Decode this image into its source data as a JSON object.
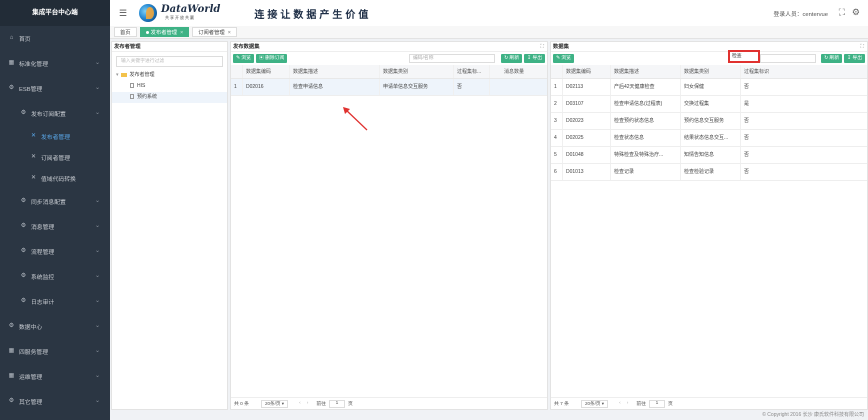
{
  "sidebar": {
    "brand": "集成平台中心端",
    "items": [
      {
        "label": "首页",
        "icon": "home-icon",
        "level": 0
      },
      {
        "label": "标准化管理",
        "icon": "grid-icon",
        "level": 0,
        "chevron": true
      },
      {
        "label": "ESB管理",
        "icon": "gear-icon",
        "level": 0,
        "chevron": true
      },
      {
        "label": "发布订阅配置",
        "icon": "gear-icon",
        "level": 1,
        "chevron": true
      },
      {
        "label": "发布者管理",
        "icon": "wrench-icon",
        "level": 2,
        "active": true
      },
      {
        "label": "订阅者管理",
        "icon": "wrench-icon",
        "level": 2
      },
      {
        "label": "值域代码转换",
        "icon": "wrench-icon",
        "level": 2
      },
      {
        "label": "同步消息配置",
        "icon": "gear-icon",
        "level": 1,
        "chevron": true
      },
      {
        "label": "消息管理",
        "icon": "gear-icon",
        "level": 1,
        "chevron": true
      },
      {
        "label": "流程管理",
        "icon": "gear-icon",
        "level": 1,
        "chevron": true
      },
      {
        "label": "系统监控",
        "icon": "gear-icon",
        "level": 1,
        "chevron": true
      },
      {
        "label": "日志审计",
        "icon": "gear-icon",
        "level": 1,
        "chevron": true
      },
      {
        "label": "数据中心",
        "icon": "gear-icon",
        "level": 0,
        "chevron": true
      },
      {
        "label": "四服务管理",
        "icon": "grid-icon",
        "level": 0,
        "chevron": true
      },
      {
        "label": "运维管理",
        "icon": "grid-icon",
        "level": 0,
        "chevron": true
      },
      {
        "label": "其它管理",
        "icon": "gear-icon",
        "level": 0,
        "chevron": true
      }
    ]
  },
  "header": {
    "logo_text": "DataWorld",
    "logo_sub": "共享开放共赢",
    "slogan": "连接让数据产生价值",
    "login_label": "登录人员：centervue"
  },
  "tabs": [
    {
      "label": "首页",
      "active": false
    },
    {
      "label": "发布者管理",
      "active": true,
      "closable": true
    },
    {
      "label": "订阅者管理",
      "active": false,
      "closable": true
    }
  ],
  "publisher_panel": {
    "title": "发布者管理",
    "search_placeholder": "输入关键字进行过滤",
    "tree": {
      "root": "发布者管理",
      "children": [
        "HIS",
        "预约系统"
      ]
    }
  },
  "dataset_panel": {
    "title": "发布数据集",
    "buttons": [
      "浏览",
      "删除订阅"
    ],
    "search_placeholder": "编码/名称",
    "right_buttons": [
      "刷新",
      "导出"
    ],
    "columns": [
      "",
      "数据集编码",
      "数据集描述",
      "数据集类别",
      "过程集标...",
      "消息数量"
    ],
    "rows": [
      [
        "1",
        "D02016",
        "检查申请信息",
        "申请单信息交互服务",
        "否",
        ""
      ]
    ],
    "pager": {
      "total": "共 0 条",
      "page_size": "20条/页",
      "goto": "前往",
      "page": "1",
      "page_unit": "页"
    }
  },
  "data_panel": {
    "title": "数据集",
    "buttons": [
      "浏览"
    ],
    "search_value": "检查",
    "right_buttons": [
      "刷新",
      "导出"
    ],
    "columns": [
      "",
      "数据集编码",
      "数据集描述",
      "数据集类别",
      "过程集标识"
    ],
    "rows": [
      [
        "1",
        "D02113",
        "产后42天健康检查",
        "妇女保健",
        "否"
      ],
      [
        "2",
        "D03107",
        "检查申请信息(过程表)",
        "交换过程集",
        "是"
      ],
      [
        "3",
        "D02023",
        "检查预约状态信息",
        "预约信息交互服务",
        "否"
      ],
      [
        "4",
        "D02025",
        "检查状态信息",
        "结果状态信息交互...",
        "否"
      ],
      [
        "5",
        "D01048",
        "特殊检查及特殊治疗...",
        "知情告知信息",
        "否"
      ],
      [
        "6",
        "D01013",
        "检查记录",
        "检查检验记录",
        "否"
      ]
    ],
    "pager": {
      "total": "共 7 条",
      "page_size": "20条/页",
      "goto": "前往",
      "page": "1",
      "page_unit": "页"
    }
  },
  "footer": {
    "copyright": "© Copyright 2016 长沙 康氏软件科技有限公司"
  },
  "colors": {
    "sidebar_bg": "#2b3643",
    "accent_green": "#3eb285",
    "highlight_red": "#e0312f",
    "active_blue": "#5aa7e8"
  }
}
